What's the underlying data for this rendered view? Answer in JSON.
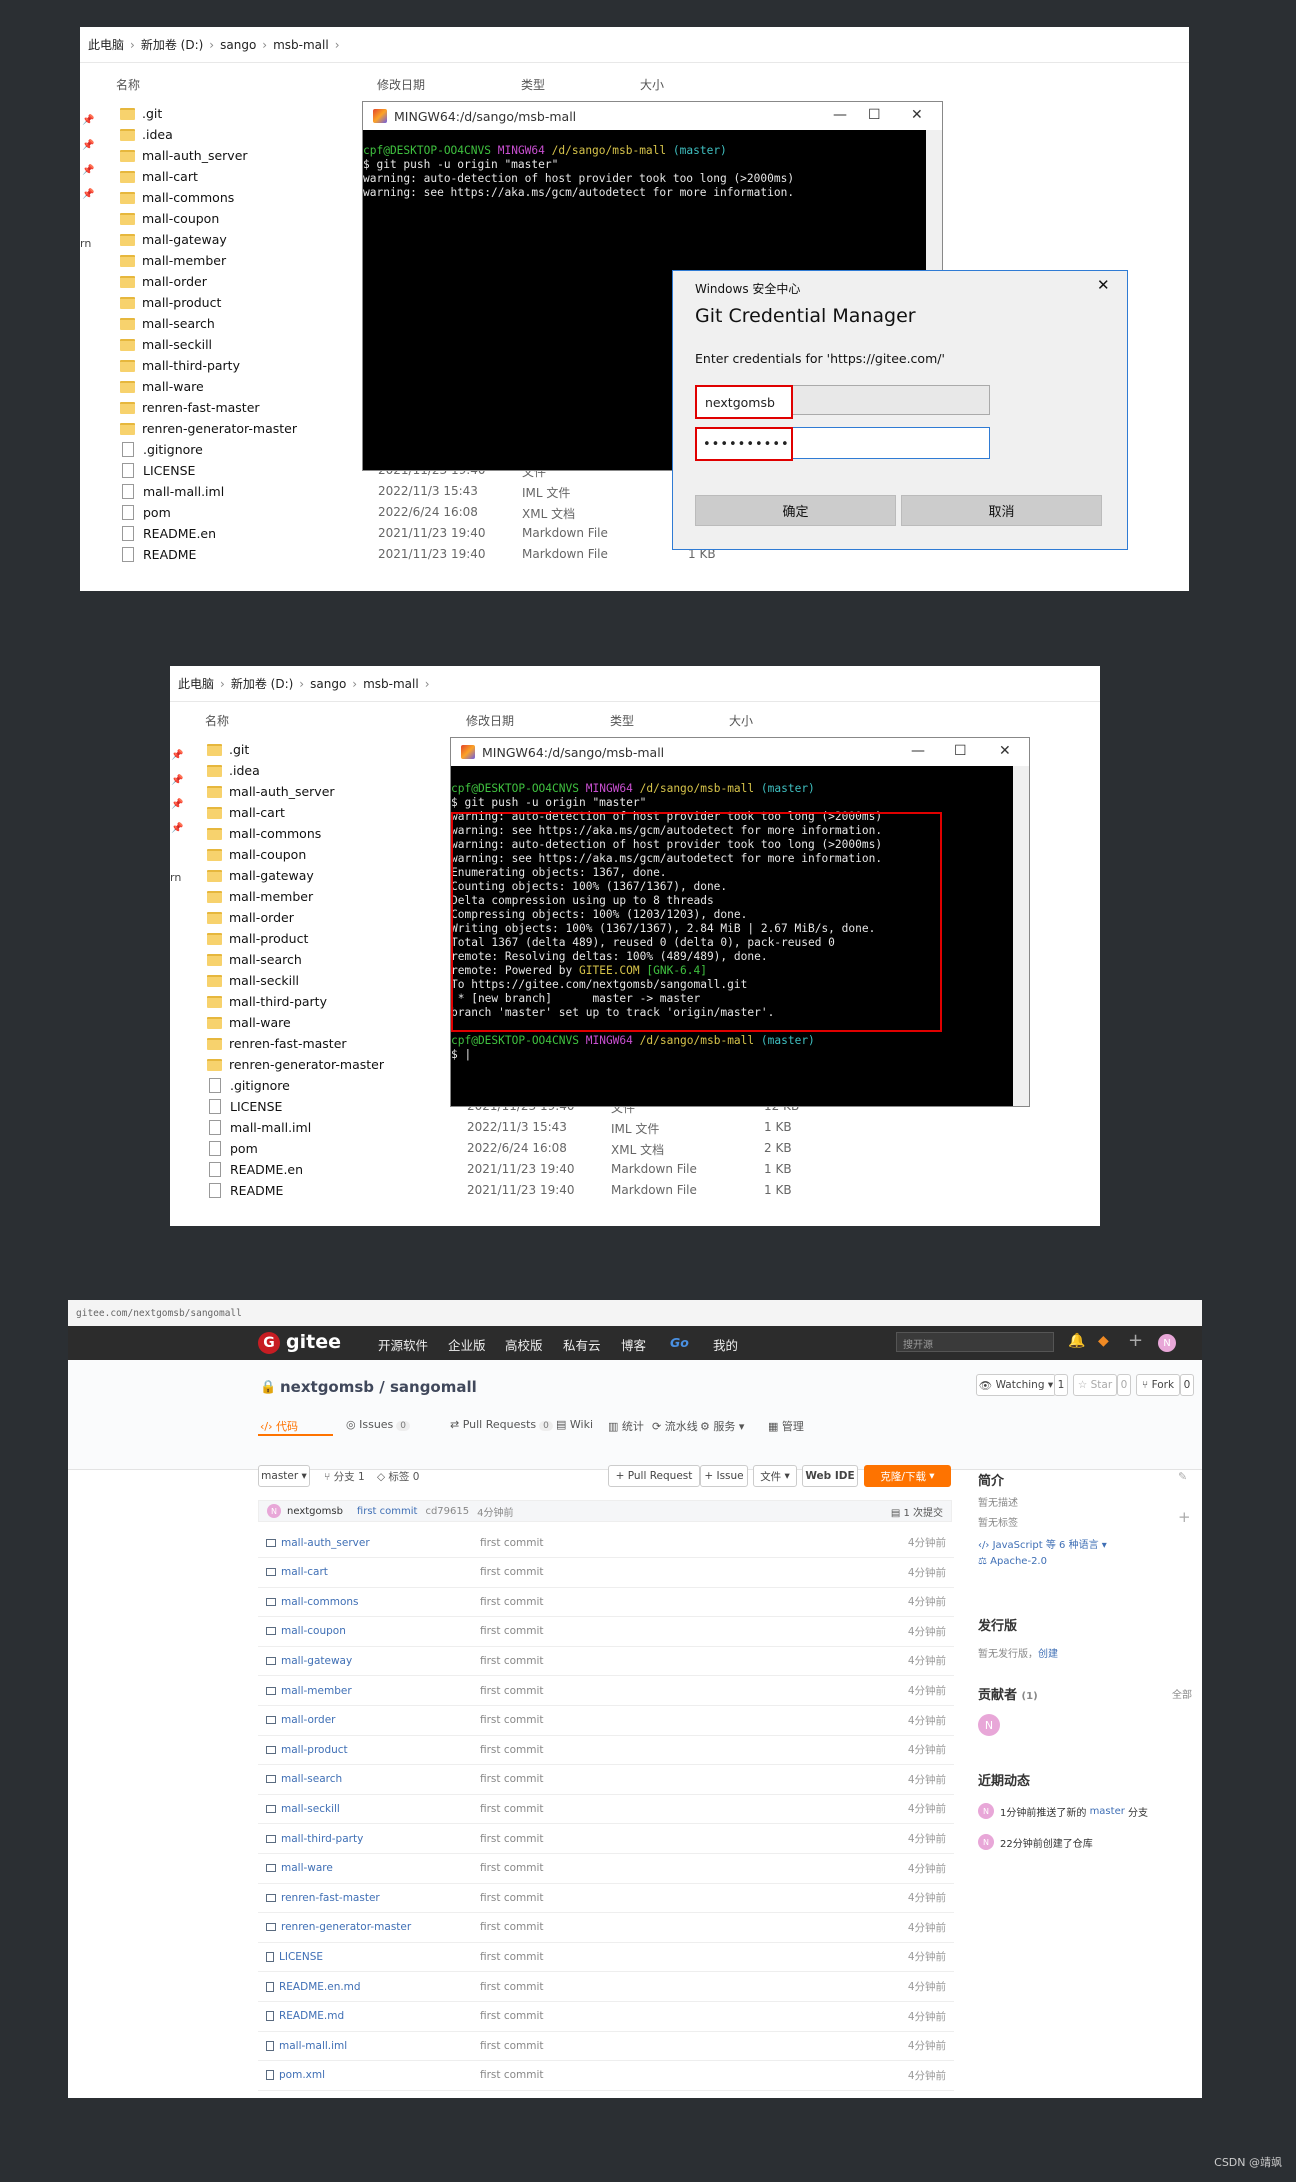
{
  "explorer1": {
    "breadcrumb": [
      "此电脑",
      "新加卷 (D:)",
      "sango",
      "msb-mall"
    ],
    "columns": {
      "name": "名称",
      "date": "修改日期",
      "type": "类型",
      "size": "大小"
    },
    "folders": [
      ".git",
      ".idea",
      "mall-auth_server",
      "mall-cart",
      "mall-commons",
      "mall-coupon",
      "mall-gateway",
      "mall-member",
      "mall-order",
      "mall-product",
      "mall-search",
      "mall-seckill",
      "mall-third-party",
      "mall-ware",
      "renren-fast-master",
      "renren-generator-master"
    ],
    "files": [
      {
        "name": ".gitignore",
        "date": "",
        "type": "",
        "size": ""
      },
      {
        "name": "LICENSE",
        "date": "2021/11/23 19:40",
        "type": "文件",
        "size": ""
      },
      {
        "name": "mall-mall.iml",
        "date": "2022/11/3 15:43",
        "type": "IML 文件",
        "size": ""
      },
      {
        "name": "pom",
        "date": "2022/6/24 16:08",
        "type": "XML 文档",
        "size": ""
      },
      {
        "name": "README.en",
        "date": "2021/11/23 19:40",
        "type": "Markdown File",
        "size": ""
      },
      {
        "name": "README",
        "date": "2021/11/23 19:40",
        "type": "Markdown File",
        "size": "1 KB"
      }
    ],
    "side_fragment": "rn"
  },
  "terminal1": {
    "title": "MINGW64:/d/sango/msb-mall",
    "prompt": {
      "user": "cpf@DESKTOP-OO4CNVS",
      "env": "MINGW64",
      "path": "/d/sango/msb-mall",
      "branch": "(master)"
    },
    "lines": [
      "$ git push -u origin \"master\"",
      "warning: auto-detection of host provider took too long (>2000ms)",
      "warning: see https://aka.ms/gcm/autodetect for more information."
    ]
  },
  "dialog": {
    "window_title": "Windows 安全中心",
    "heading": "Git Credential Manager",
    "prompt": "Enter credentials for 'https://gitee.com/'",
    "username": "nextgomsb",
    "password_mask": "••••••••••",
    "ok": "确定",
    "cancel": "取消"
  },
  "explorer2": {
    "breadcrumb": [
      "此电脑",
      "新加卷 (D:)",
      "sango",
      "msb-mall"
    ],
    "columns": {
      "name": "名称",
      "date": "修改日期",
      "type": "类型",
      "size": "大小"
    },
    "folders": [
      ".git",
      ".idea",
      "mall-auth_server",
      "mall-cart",
      "mall-commons",
      "mall-coupon",
      "mall-gateway",
      "mall-member",
      "mall-order",
      "mall-product",
      "mall-search",
      "mall-seckill",
      "mall-third-party",
      "mall-ware",
      "renren-fast-master",
      "renren-generator-master"
    ],
    "files": [
      {
        "name": ".gitignore",
        "date": "",
        "type": "",
        "size": ""
      },
      {
        "name": "LICENSE",
        "date": "2021/11/23 19:40",
        "type": "文件",
        "size": "12 KB"
      },
      {
        "name": "mall-mall.iml",
        "date": "2022/11/3 15:43",
        "type": "IML 文件",
        "size": "1 KB"
      },
      {
        "name": "pom",
        "date": "2022/6/24 16:08",
        "type": "XML 文档",
        "size": "2 KB"
      },
      {
        "name": "README.en",
        "date": "2021/11/23 19:40",
        "type": "Markdown File",
        "size": "1 KB"
      },
      {
        "name": "README",
        "date": "2021/11/23 19:40",
        "type": "Markdown File",
        "size": "1 KB"
      }
    ],
    "side_fragment": "rn"
  },
  "terminal2": {
    "title": "MINGW64:/d/sango/msb-mall",
    "prompt": {
      "user": "cpf@DESKTOP-OO4CNVS",
      "env": "MINGW64",
      "path": "/d/sango/msb-mall",
      "branch": "(master)"
    },
    "cmd": "$ git push -u origin \"master\"",
    "output": [
      "warning: auto-detection of host provider took too long (>2000ms)",
      "warning: see https://aka.ms/gcm/autodetect for more information.",
      "warning: auto-detection of host provider took too long (>2000ms)",
      "warning: see https://aka.ms/gcm/autodetect for more information.",
      "Enumerating objects: 1367, done.",
      "Counting objects: 100% (1367/1367), done.",
      "Delta compression using up to 8 threads",
      "Compressing objects: 100% (1203/1203), done.",
      "Writing objects: 100% (1367/1367), 2.84 MiB | 2.67 MiB/s, done.",
      "Total 1367 (delta 489), reused 0 (delta 0), pack-reused 0",
      "remote: Resolving deltas: 100% (489/489), done.",
      "remote: Powered by",
      "To https://gitee.com/nextgomsb/sangomall.git",
      " * [new branch]      master -> master",
      "branch 'master' set up to track 'origin/master'."
    ],
    "powered": "GITEE.COM",
    "gnk": "[GNK-6.4]",
    "final_prompt": "$ |"
  },
  "gitee": {
    "url": "gitee.com/nextgomsb/sangomall",
    "brand": "gitee",
    "nav": [
      "开源软件",
      "企业版",
      "高校版",
      "私有云",
      "博客",
      "Go",
      "我的"
    ],
    "search_placeholder": "搜开源",
    "avatar_letter": "N",
    "repo_title": "nextgomsb / sangomall",
    "watch": "Watching",
    "watch_count": "1",
    "star": "Star",
    "star_count": "0",
    "fork": "Fork",
    "fork_count": "0",
    "tabs": [
      {
        "label": "代码",
        "count": ""
      },
      {
        "label": "Issues",
        "count": "0"
      },
      {
        "label": "Pull Requests",
        "count": "0"
      },
      {
        "label": "Wiki",
        "count": ""
      },
      {
        "label": "统计",
        "count": ""
      },
      {
        "label": "流水线",
        "count": ""
      },
      {
        "label": "服务",
        "count": ""
      },
      {
        "label": "管理",
        "count": ""
      }
    ],
    "branch": "master",
    "branches": "分支 1",
    "tags": "标签 0",
    "pull_request": "+ Pull Request",
    "issue": "+ Issue",
    "file_btn": "文件",
    "web_ide": "Web IDE",
    "clone": "克隆/下载",
    "commit": {
      "author": "nextgomsb",
      "message": "first commit",
      "hash": "cd79615",
      "time": "4分钟前",
      "count": "1 次提交"
    },
    "entries": [
      {
        "name": "mall-auth_server",
        "msg": "first commit",
        "time": "4分钟前"
      },
      {
        "name": "mall-cart",
        "msg": "first commit",
        "time": "4分钟前"
      },
      {
        "name": "mall-commons",
        "msg": "first commit",
        "time": "4分钟前"
      },
      {
        "name": "mall-coupon",
        "msg": "first commit",
        "time": "4分钟前"
      },
      {
        "name": "mall-gateway",
        "msg": "first commit",
        "time": "4分钟前"
      },
      {
        "name": "mall-member",
        "msg": "first commit",
        "time": "4分钟前"
      },
      {
        "name": "mall-order",
        "msg": "first commit",
        "time": "4分钟前"
      },
      {
        "name": "mall-product",
        "msg": "first commit",
        "time": "4分钟前"
      },
      {
        "name": "mall-search",
        "msg": "first commit",
        "time": "4分钟前"
      },
      {
        "name": "mall-seckill",
        "msg": "first commit",
        "time": "4分钟前"
      },
      {
        "name": "mall-third-party",
        "msg": "first commit",
        "time": "4分钟前"
      },
      {
        "name": "mall-ware",
        "msg": "first commit",
        "time": "4分钟前"
      },
      {
        "name": "renren-fast-master",
        "msg": "first commit",
        "time": "4分钟前"
      },
      {
        "name": "renren-generator-master",
        "msg": "first commit",
        "time": "4分钟前"
      },
      {
        "name": "LICENSE",
        "msg": "first commit",
        "time": "4分钟前"
      },
      {
        "name": "README.en.md",
        "msg": "first commit",
        "time": "4分钟前"
      },
      {
        "name": "README.md",
        "msg": "first commit",
        "time": "4分钟前"
      },
      {
        "name": "mall-mall.iml",
        "msg": "first commit",
        "time": "4分钟前"
      },
      {
        "name": "pom.xml",
        "msg": "first commit",
        "time": "4分钟前"
      }
    ],
    "sidebar": {
      "intro_title": "简介",
      "no_desc": "暂无描述",
      "no_tags": "暂无标签",
      "lang": "JavaScript 等 6 种语言",
      "license": "Apache-2.0",
      "release_title": "发行版",
      "no_release": "暂无发行版，",
      "create": "创建",
      "contrib_title": "贡献者",
      "contrib_count": "(1)",
      "all": "全部",
      "activity_title": "近期动态",
      "act1_pre": "1分钟前推送了新的",
      "act1_branch": "master",
      "act1_post": "分支",
      "act2": "22分钟前创建了仓库"
    }
  },
  "watermark": "CSDN @靖飒"
}
